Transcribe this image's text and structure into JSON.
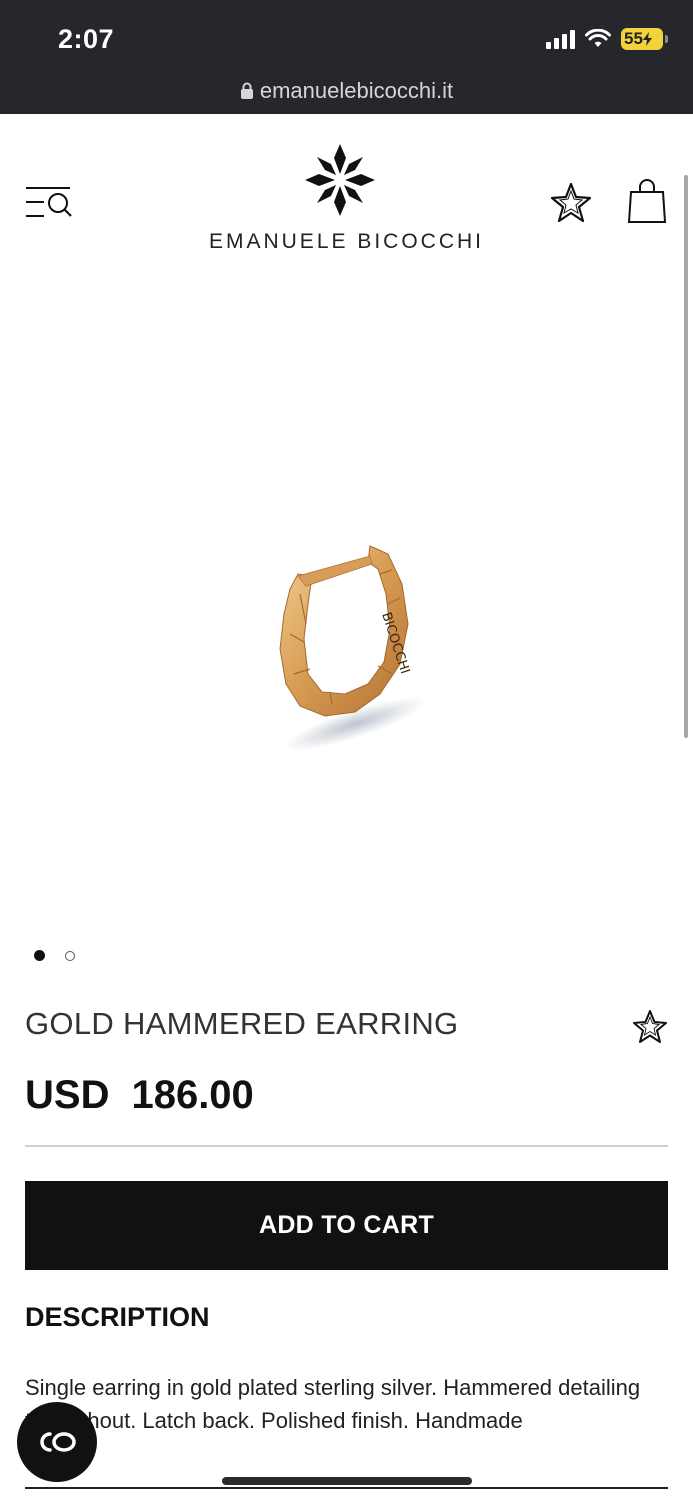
{
  "status_bar": {
    "time": "2:07",
    "battery": "55"
  },
  "browser": {
    "url": "emanuelebicocchi.it"
  },
  "header": {
    "brand": "EMANUELE BICOCCHI"
  },
  "product": {
    "name": "GOLD HAMMERED EARRING",
    "currency": "USD",
    "price": "186.00",
    "image_count": 2,
    "active_image": 1,
    "engraving": "BICOCCHI"
  },
  "actions": {
    "add_to_cart": "ADD TO CART"
  },
  "description": {
    "title": "DESCRIPTION",
    "text": "Single earring in gold plated sterling silver. Hammered detailing throughout. Latch back. Polished finish. Handmade"
  },
  "colors": {
    "topbar": "#25272c",
    "button": "#111111",
    "battery": "#f3d23a",
    "gold": "#d9a25a"
  },
  "icons": {
    "menu": "menu-search-icon",
    "wishlist": "star-icon",
    "bag": "shopping-bag-icon",
    "chat": "chat-icon",
    "lock": "lock-icon"
  }
}
